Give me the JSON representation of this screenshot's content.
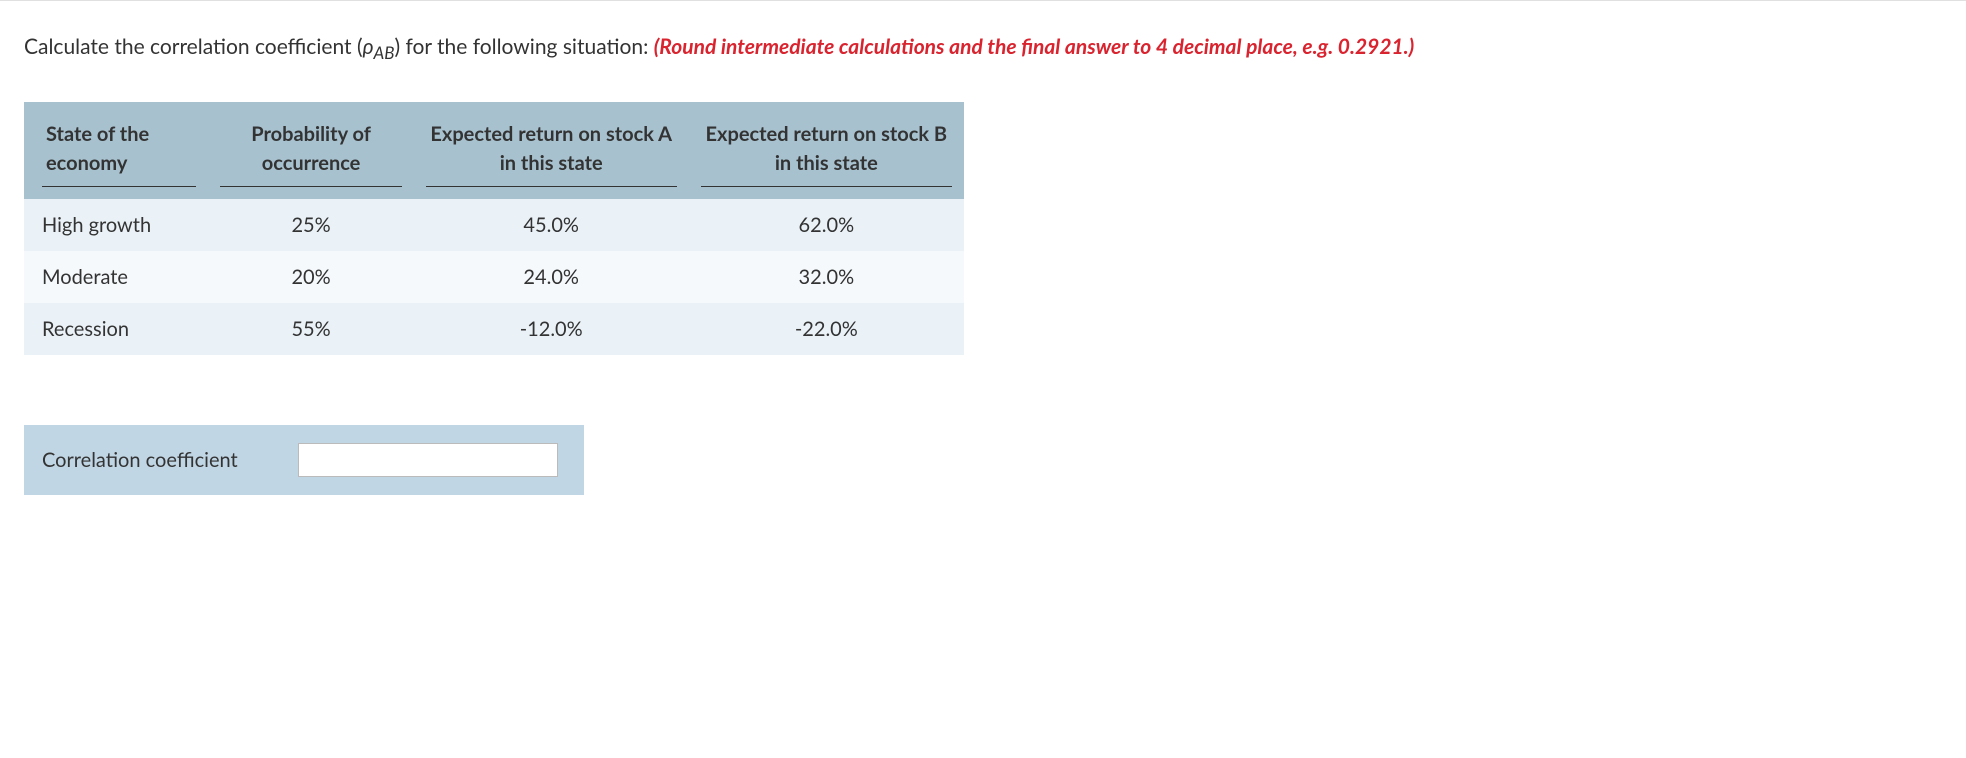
{
  "prompt": {
    "pre": "Calculate the correlation coefficient (",
    "symbol_main": "ρ",
    "symbol_sub": "AB",
    "post": ") for the following situation: ",
    "highlight": "(Round intermediate calculations and the final answer to 4 decimal place, e.g. 0.2921.)"
  },
  "table": {
    "headers": [
      "State of the economy",
      "Probability of occurrence",
      "Expected return on stock A in this state",
      "Expected return on stock B in this state"
    ],
    "rows": [
      {
        "state": "High growth",
        "prob": "25%",
        "a": "45.0%",
        "b": "62.0%"
      },
      {
        "state": "Moderate",
        "prob": "20%",
        "a": "24.0%",
        "b": "32.0%"
      },
      {
        "state": "Recession",
        "prob": "55%",
        "a": "-12.0%",
        "b": "-22.0%"
      }
    ]
  },
  "answer": {
    "label": "Correlation coefficient",
    "value": ""
  }
}
